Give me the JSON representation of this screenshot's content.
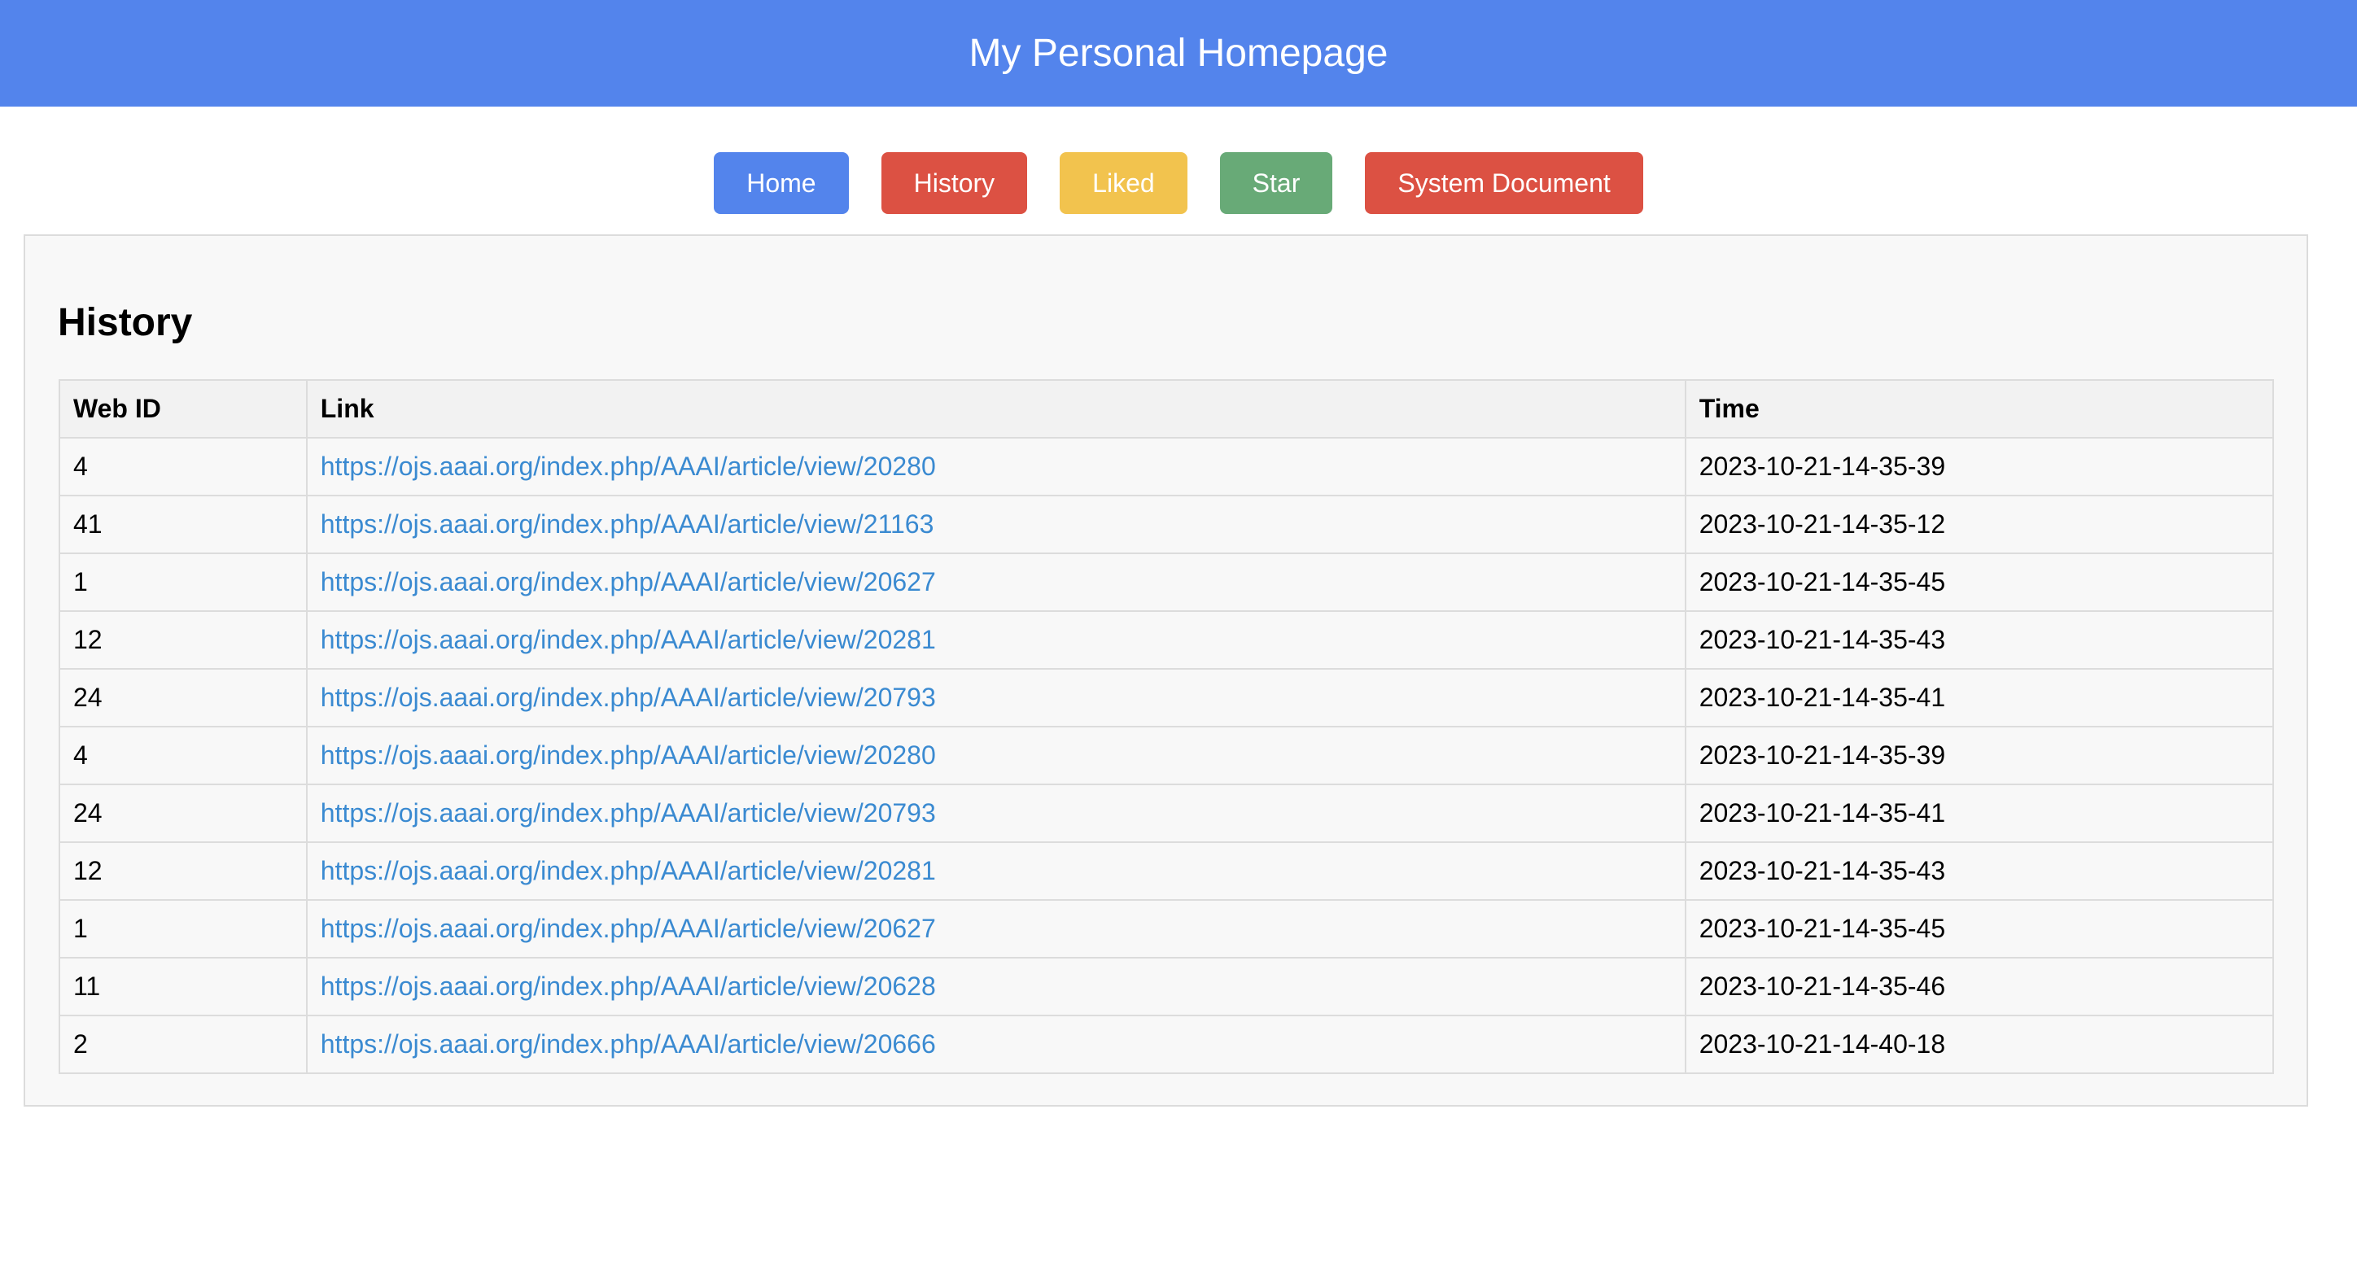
{
  "header": {
    "title": "My Personal Homepage"
  },
  "nav": {
    "buttons": [
      {
        "label": "Home",
        "color": "#5384ec"
      },
      {
        "label": "History",
        "color": "#dc5143"
      },
      {
        "label": "Liked",
        "color": "#f2c34e"
      },
      {
        "label": "Star",
        "color": "#68aa77"
      },
      {
        "label": "System Document",
        "color": "#dc5143"
      }
    ]
  },
  "history": {
    "title": "History",
    "columns": [
      "Web ID",
      "Link",
      "Time"
    ],
    "rows": [
      {
        "web_id": "4",
        "link": "https://ojs.aaai.org/index.php/AAAI/article/view/20280",
        "time": "2023-10-21-14-35-39"
      },
      {
        "web_id": "41",
        "link": "https://ojs.aaai.org/index.php/AAAI/article/view/21163",
        "time": "2023-10-21-14-35-12"
      },
      {
        "web_id": "1",
        "link": "https://ojs.aaai.org/index.php/AAAI/article/view/20627",
        "time": "2023-10-21-14-35-45"
      },
      {
        "web_id": "12",
        "link": "https://ojs.aaai.org/index.php/AAAI/article/view/20281",
        "time": "2023-10-21-14-35-43"
      },
      {
        "web_id": "24",
        "link": "https://ojs.aaai.org/index.php/AAAI/article/view/20793",
        "time": "2023-10-21-14-35-41"
      },
      {
        "web_id": "4",
        "link": "https://ojs.aaai.org/index.php/AAAI/article/view/20280",
        "time": "2023-10-21-14-35-39"
      },
      {
        "web_id": "24",
        "link": "https://ojs.aaai.org/index.php/AAAI/article/view/20793",
        "time": "2023-10-21-14-35-41"
      },
      {
        "web_id": "12",
        "link": "https://ojs.aaai.org/index.php/AAAI/article/view/20281",
        "time": "2023-10-21-14-35-43"
      },
      {
        "web_id": "1",
        "link": "https://ojs.aaai.org/index.php/AAAI/article/view/20627",
        "time": "2023-10-21-14-35-45"
      },
      {
        "web_id": "11",
        "link": "https://ojs.aaai.org/index.php/AAAI/article/view/20628",
        "time": "2023-10-21-14-35-46"
      },
      {
        "web_id": "2",
        "link": "https://ojs.aaai.org/index.php/AAAI/article/view/20666",
        "time": "2023-10-21-14-40-18"
      }
    ]
  },
  "colors": {
    "header_bg": "#5384ec",
    "link": "#3a8ad1",
    "panel_bg": "#f8f8f8",
    "border": "#dcdcdc"
  }
}
